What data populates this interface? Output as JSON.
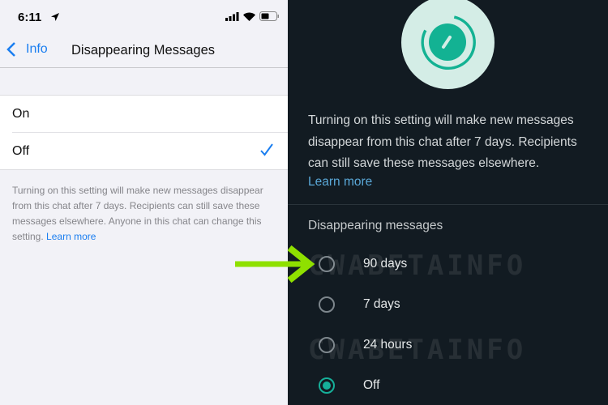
{
  "status_bar": {
    "time": "6:11"
  },
  "nav": {
    "back_label": "Info",
    "title": "Disappearing Messages"
  },
  "ios_options": [
    {
      "label": "On",
      "selected": false
    },
    {
      "label": "Off",
      "selected": true
    }
  ],
  "ios_footer": {
    "text": "Turning on this setting will make new messages disappear from this chat after 7 days. Recipients can still save these messages elsewhere. Anyone in this chat can change this setting.",
    "link": "Learn more"
  },
  "android": {
    "description": "Turning on this setting will make new messages disappear from this chat after 7 days. Recipients can still save these messages elsewhere.",
    "learn_more": "Learn more",
    "section_title": "Disappearing messages",
    "options": [
      {
        "label": "90 days",
        "selected": false
      },
      {
        "label": "7 days",
        "selected": false
      },
      {
        "label": "24 hours",
        "selected": false
      },
      {
        "label": "Off",
        "selected": true
      }
    ]
  },
  "watermark": "CWABETAINFO",
  "colors": {
    "ios_accent": "#1a7ef0",
    "wa_green": "#16b09a",
    "arrow": "#8fe000"
  }
}
